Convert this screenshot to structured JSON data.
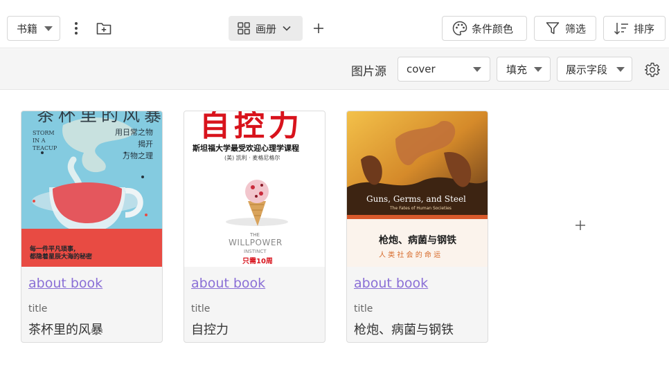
{
  "toolbar": {
    "table_select": "书籍",
    "view_label": "画册",
    "color_button": "条件颜色",
    "filter_button": "筛选",
    "sort_button": "排序"
  },
  "sub_toolbar": {
    "image_source_label": "图片源",
    "image_source_value": "cover",
    "fit_value": "填充",
    "fields_label": "展示字段"
  },
  "cards": [
    {
      "link": "about book",
      "field_label": "title",
      "title": "茶杯里的风暴",
      "cover": {
        "title_text": "茶杯里的风暴",
        "en_lines": [
          "STORM",
          "IN A",
          "TEACUP"
        ],
        "tagline": [
          "用日常之物",
          "揭开",
          "万物之理"
        ],
        "bottom_lines": [
          "每一件平凡琐事,",
          "都隐着星辰大海的秘密"
        ]
      }
    },
    {
      "link": "about book",
      "field_label": "title",
      "title": "自控力",
      "cover": {
        "title_text": "自控力",
        "subtitle": "斯坦福大学最受欢迎心理学课程",
        "author": "(美) 凯利 · 麦格尼格尔",
        "en_small": "THE",
        "en_big": "WILLPOWER",
        "en_sub": "INSTINCT",
        "red_line": "只需10周"
      }
    },
    {
      "link": "about book",
      "field_label": "title",
      "title": "枪炮、病菌与钢铁",
      "cover": {
        "en_title": "Guns, Germs, and Steel",
        "en_sub": "The Fates of Human Societies",
        "cn_title": "枪炮、病菌与钢铁",
        "cn_sub": "人 类 社 会 的 命 运"
      }
    }
  ],
  "colors": {
    "link": "#8a6fd6",
    "border": "#d6d6d6",
    "card_bg": "#f5f5f5"
  }
}
